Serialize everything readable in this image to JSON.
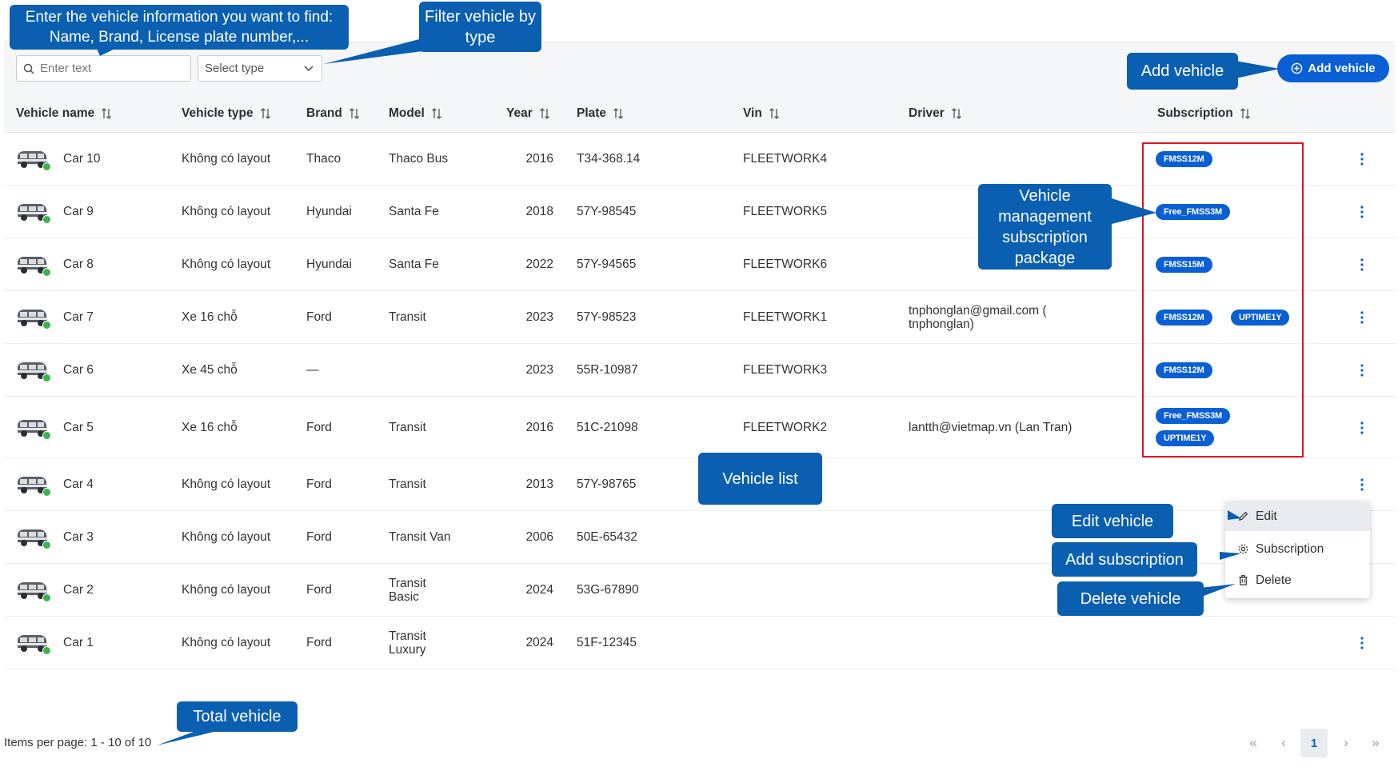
{
  "filters": {
    "search_placeholder": "Enter text",
    "type_placeholder": "Select type"
  },
  "add_vehicle_label": "Add vehicle",
  "columns": [
    "Vehicle name",
    "Vehicle type",
    "Brand",
    "Model",
    "Year",
    "Plate",
    "Vin",
    "Driver",
    "Subscription"
  ],
  "rows": [
    {
      "name": "Car 10",
      "type": "Không có layout",
      "brand": "Thaco",
      "model": "Thaco Bus",
      "year": "2016",
      "plate": "T34-368.14",
      "vin": "FLEETWORK4",
      "driver": "",
      "subs": [
        "FMSS12M"
      ]
    },
    {
      "name": "Car 9",
      "type": "Không có layout",
      "brand": "Hyundai",
      "model": "Santa Fe",
      "year": "2018",
      "plate": "57Y-98545",
      "vin": "FLEETWORK5",
      "driver": "",
      "subs": [
        "Free_FMSS3M"
      ]
    },
    {
      "name": "Car 8",
      "type": "Không có layout",
      "brand": "Hyundai",
      "model": "Santa Fe",
      "year": "2022",
      "plate": "57Y-94565",
      "vin": "FLEETWORK6",
      "driver": "",
      "subs": [
        "FMSS15M"
      ]
    },
    {
      "name": "Car 7",
      "type": "Xe 16 chỗ",
      "brand": "Ford",
      "model": "Transit",
      "year": "2023",
      "plate": "57Y-98523",
      "vin": "FLEETWORK1",
      "driver": "tnphonglan@gmail.com ( tnphonglan)",
      "subs": [
        "FMSS12M",
        "UPTIME1Y"
      ]
    },
    {
      "name": "Car 6",
      "type": "Xe 45 chỗ",
      "brand": "—",
      "model": "",
      "year": "2023",
      "plate": "55R-10987",
      "vin": "FLEETWORK3",
      "driver": "",
      "subs": [
        "FMSS12M"
      ]
    },
    {
      "name": "Car 5",
      "type": "Xe 16 chỗ",
      "brand": "Ford",
      "model": "Transit",
      "year": "2016",
      "plate": "51C-21098",
      "vin": "FLEETWORK2",
      "driver": "lantth@vietmap.vn (Lan Tran)",
      "subs": [
        "Free_FMSS3M",
        "UPTIME1Y"
      ]
    },
    {
      "name": "Car 4",
      "type": "Không có layout",
      "brand": "Ford",
      "model": "Transit",
      "year": "2013",
      "plate": "57Y-98765",
      "vin": "",
      "driver": "",
      "subs": []
    },
    {
      "name": "Car 3",
      "type": "Không có layout",
      "brand": "Ford",
      "model": "Transit Van",
      "year": "2006",
      "plate": "50E-65432",
      "vin": "",
      "driver": "",
      "subs": []
    },
    {
      "name": "Car 2",
      "type": "Không có layout",
      "brand": "Ford",
      "model": "Transit Basic",
      "year": "2024",
      "plate": "53G-67890",
      "vin": "",
      "driver": "",
      "subs": []
    },
    {
      "name": "Car 1",
      "type": "Không có layout",
      "brand": "Ford",
      "model": "Transit Luxury",
      "year": "2024",
      "plate": "51F-12345",
      "vin": "",
      "driver": "",
      "subs": []
    }
  ],
  "row_menu": {
    "edit": "Edit",
    "subscription": "Subscription",
    "delete": "Delete"
  },
  "footer": {
    "items_per_page": "Items per page: 1 - 10 of 10",
    "current_page": "1"
  },
  "callouts": {
    "search": "Enter the vehicle information you want to find: Name, Brand, License plate number,...",
    "filter": "Filter vehicle by type",
    "add": "Add vehicle",
    "subscription": "Vehicle management subscription package",
    "list": "Vehicle list",
    "edit": "Edit vehicle",
    "add_sub": "Add subscription",
    "delete": "Delete vehicle",
    "total": "Total vehicle"
  },
  "colors": {
    "accent": "#0a5fd4",
    "callout": "#0a5fb0",
    "highlight": "#e0141e",
    "online": "#3cb44b"
  }
}
